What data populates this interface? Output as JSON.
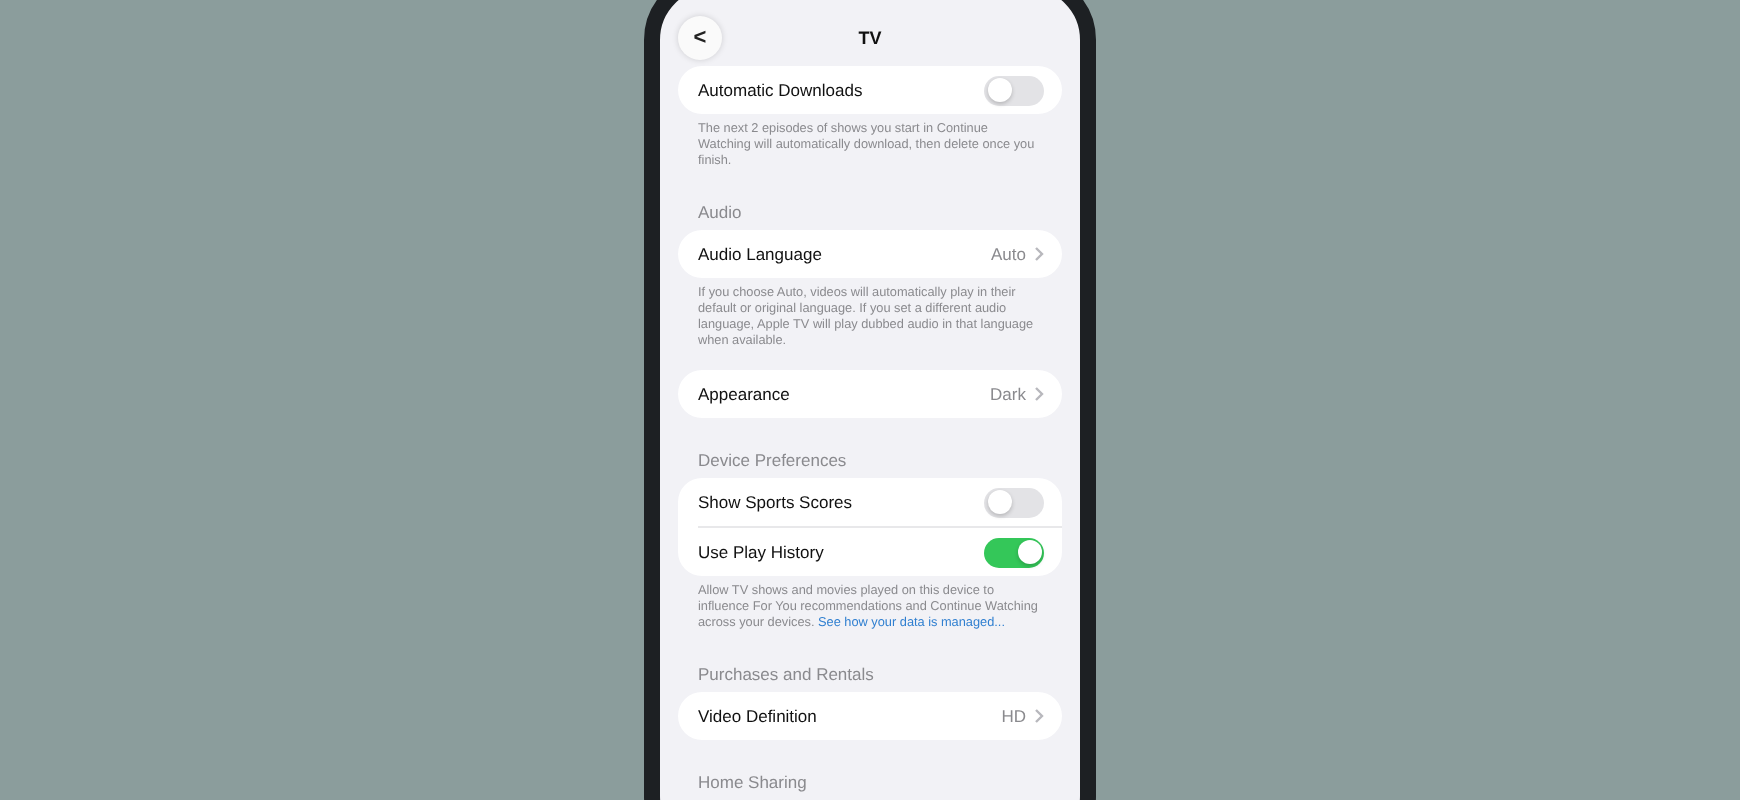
{
  "nav": {
    "title": "TV",
    "back_label": "<"
  },
  "sections": [
    {
      "rows": [
        {
          "kind": "toggle",
          "label": "Automatic Downloads",
          "on": false
        }
      ],
      "footer": "The next 2 episodes of shows you start in Continue Watching will automatically download, then delete once you finish."
    },
    {
      "header": "Audio",
      "rows": [
        {
          "kind": "link",
          "label": "Audio Language",
          "value": "Auto"
        }
      ],
      "footer": "If you choose Auto, videos will automatically play in their default or original language. If you set a different audio language, Apple TV will play dubbed audio in that language when available."
    },
    {
      "rows": [
        {
          "kind": "link",
          "label": "Appearance",
          "value": "Dark"
        }
      ]
    },
    {
      "header": "Device Preferences",
      "rows": [
        {
          "kind": "toggle",
          "label": "Show Sports Scores",
          "on": false
        },
        {
          "kind": "toggle",
          "label": "Use Play History",
          "on": true
        }
      ],
      "footer": "Allow TV shows and movies played on this device to influence For You recommendations and Continue Watching across your devices.",
      "footer_link": "See how your data is managed..."
    },
    {
      "header": "Purchases and Rentals",
      "rows": [
        {
          "kind": "link",
          "label": "Video Definition",
          "value": "HD"
        }
      ]
    },
    {
      "header": "Home Sharing"
    }
  ]
}
